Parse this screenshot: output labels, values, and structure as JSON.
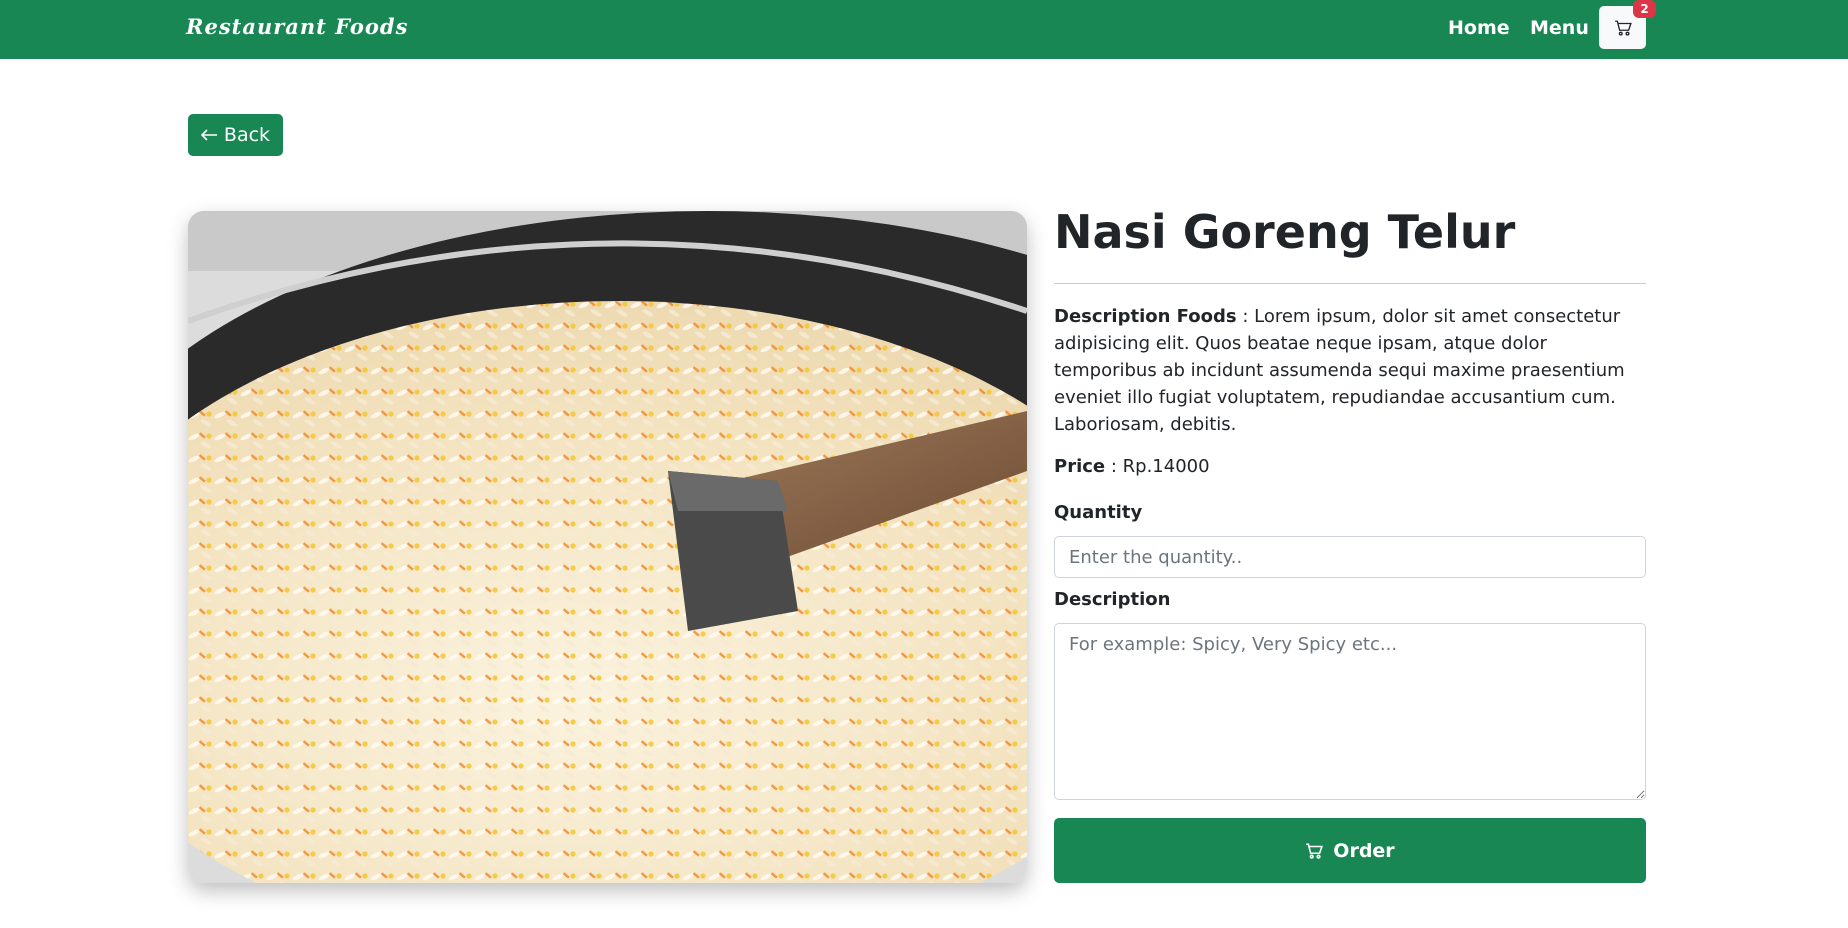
{
  "navbar": {
    "brand": "Restaurant Foods",
    "home_label": "Home",
    "menu_label": "Menu",
    "cart_count": "2"
  },
  "back_button": {
    "label": "Back"
  },
  "food": {
    "name": "Nasi Goreng Telur",
    "description_label": "Description Foods",
    "description": "Lorem ipsum, dolor sit amet consectetur adipisicing elit. Quos beatae neque ipsam, atque dolor temporibus ab incidunt assumenda sequi maxime praesentium eveniet illo fugiat voluptatem, repudiandae accusantium cum. Laboriosam, debitis.",
    "price_label": "Price",
    "price": "Rp.14000"
  },
  "form": {
    "quantity_label": "Quantity",
    "quantity_placeholder": "Enter the quantity..",
    "description_label": "Description",
    "description_placeholder": "For example: Spicy, Very Spicy etc...",
    "order_label": "Order"
  },
  "colors": {
    "primary": "#198754",
    "badge": "#dc3545"
  }
}
